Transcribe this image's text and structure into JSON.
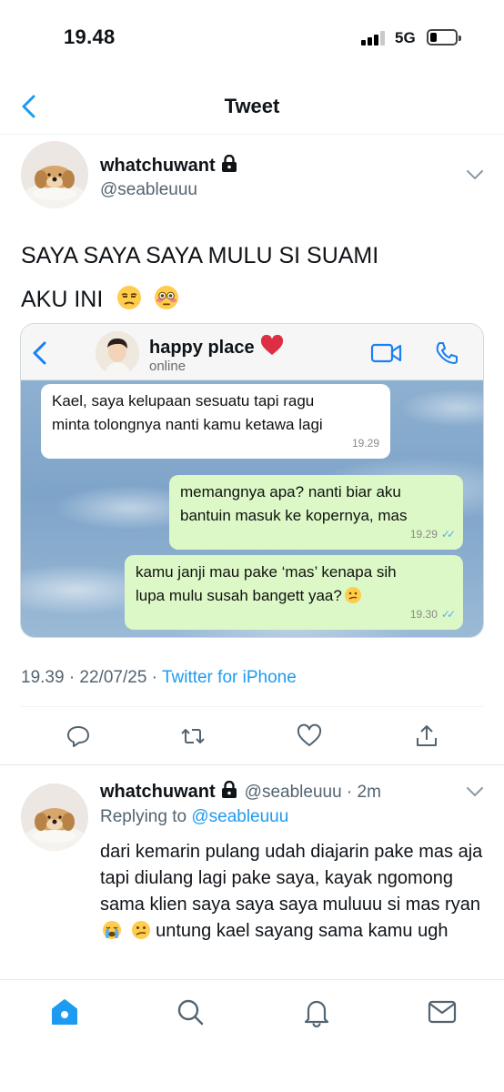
{
  "status_bar": {
    "time": "19.48",
    "network": "5G"
  },
  "nav": {
    "title": "Tweet",
    "back_icon": "chevron-left-icon"
  },
  "tweet": {
    "display_name": "whatchuwant",
    "handle": "@seableuuu",
    "text_line1": "SAYA SAYA SAYA MULU SI SUAMI",
    "text_line2": "AKU INI",
    "emojis": [
      "unamused-face",
      "flushed-face"
    ],
    "timestamp": "19.39 · 22/07/25 · ",
    "source": "Twitter for iPhone"
  },
  "chat": {
    "name": "happy place",
    "status": "online",
    "messages": [
      {
        "direction": "in",
        "line1": "Kael, saya kelupaan sesuatu tapi ragu",
        "line2": "minta tolongnya nanti kamu ketawa lagi",
        "time": "19.29"
      },
      {
        "direction": "out",
        "line1": "memangnya apa? nanti biar aku",
        "line2": "bantuin masuk ke kopernya, mas",
        "time": "19.29",
        "ticks": "✓✓"
      },
      {
        "direction": "out",
        "line1": "kamu janji mau pake ‘mas’ kenapa sih",
        "line2": "lupa mulu susah bangett yaa?",
        "time": "19.30",
        "ticks": "✓✓"
      }
    ]
  },
  "actions": [
    "reply-icon",
    "retweet-icon",
    "like-icon",
    "share-icon"
  ],
  "reply": {
    "display_name": "whatchuwant",
    "handle_time": "@seableuuu · 2m",
    "replying_label": "Replying to ",
    "replying_handle": "@seableuuu",
    "text": "dari kemarin pulang udah diajarin pake mas aja tapi diulang lagi pake saya, kayak ngomong sama klien saya saya saya muluuu si mas ryan",
    "text_tail": " untung kael sayang sama kamu ugh"
  },
  "tabbar": [
    "home-icon",
    "search-icon",
    "notifications-icon",
    "messages-icon"
  ],
  "colors": {
    "accent": "#1d9bf0",
    "bubble_out": "#dcf8c6",
    "bubble_in": "#ffffff"
  }
}
